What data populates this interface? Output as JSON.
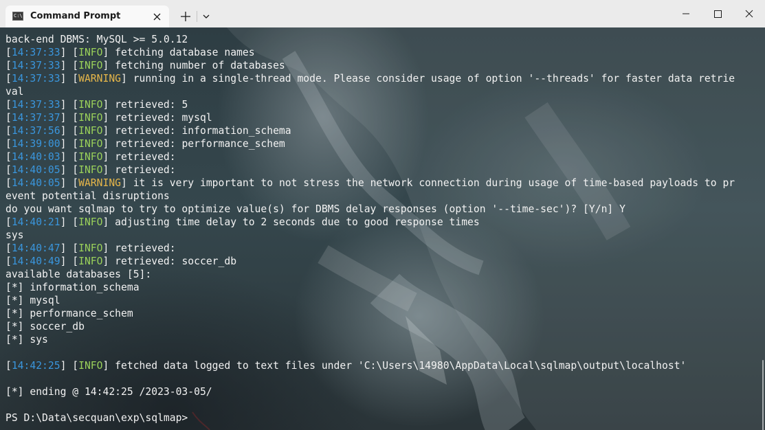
{
  "window": {
    "tab_title": "Command Prompt",
    "tab_icon_label": "C:\\",
    "icons": {
      "tab": "console-icon",
      "close_tab": "close-icon",
      "new_tab": "plus-icon",
      "dropdown": "chevron-down-icon",
      "minimize": "minimize-icon",
      "maximize": "maximize-icon",
      "close": "close-icon"
    }
  },
  "colors": {
    "timestamp": "#3a96dd",
    "info": "#9ad15a",
    "warning": "#e5b64a",
    "text": "#f2f2f2"
  },
  "terminal": {
    "lines": [
      {
        "text": "back-end DBMS: MySQL >= 5.0.12"
      },
      {
        "ts": "14:37:33",
        "level": "INFO",
        "msg": " fetching database names"
      },
      {
        "ts": "14:37:33",
        "level": "INFO",
        "msg": " fetching number of databases"
      },
      {
        "ts": "14:37:33",
        "level": "WARNING",
        "msg": " running in a single-thread mode. Please consider usage of option '--threads' for faster data retrie"
      },
      {
        "text": "val"
      },
      {
        "ts": "14:37:33",
        "level": "INFO",
        "msg": " retrieved: 5"
      },
      {
        "ts": "14:37:37",
        "level": "INFO",
        "msg": " retrieved: mysql"
      },
      {
        "ts": "14:37:56",
        "level": "INFO",
        "msg": " retrieved: information_schema"
      },
      {
        "ts": "14:39:00",
        "level": "INFO",
        "msg": " retrieved: performance_schem"
      },
      {
        "ts": "14:40:03",
        "level": "INFO",
        "msg": " retrieved:"
      },
      {
        "ts": "14:40:05",
        "level": "INFO",
        "msg": " retrieved:"
      },
      {
        "ts": "14:40:05",
        "level": "WARNING",
        "msg": " it is very important to not stress the network connection during usage of time-based payloads to pr"
      },
      {
        "text": "event potential disruptions"
      },
      {
        "text": "do you want sqlmap to try to optimize value(s) for DBMS delay responses (option '--time-sec')? [Y/n] Y"
      },
      {
        "ts": "14:40:21",
        "level": "INFO",
        "msg": " adjusting time delay to 2 seconds due to good response times"
      },
      {
        "text": "sys"
      },
      {
        "ts": "14:40:47",
        "level": "INFO",
        "msg": " retrieved:"
      },
      {
        "ts": "14:40:49",
        "level": "INFO",
        "msg": " retrieved: soccer_db"
      },
      {
        "text": "available databases [5]:"
      },
      {
        "text": "[*] information_schema"
      },
      {
        "text": "[*] mysql"
      },
      {
        "text": "[*] performance_schem"
      },
      {
        "text": "[*] soccer_db"
      },
      {
        "text": "[*] sys"
      },
      {
        "text": ""
      },
      {
        "ts": "14:42:25",
        "level": "INFO",
        "msg": " fetched data logged to text files under 'C:\\Users\\14980\\AppData\\Local\\sqlmap\\output\\localhost'"
      },
      {
        "text": ""
      },
      {
        "text": "[*] ending @ 14:42:25 /2023-03-05/"
      },
      {
        "text": ""
      },
      {
        "text": "PS D:\\Data\\secquan\\exp\\sqlmap>"
      }
    ]
  }
}
